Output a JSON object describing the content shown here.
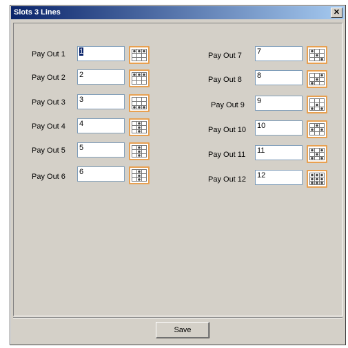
{
  "window": {
    "title": "Slots 3 Lines"
  },
  "payouts": [
    {
      "label": "Pay Out 1",
      "value": "1",
      "icon": "payline-top-row-icon"
    },
    {
      "label": "Pay Out 2",
      "value": "2",
      "icon": "payline-top-row-icon"
    },
    {
      "label": "Pay Out 3",
      "value": "3",
      "icon": "payline-bottom-row-icon"
    },
    {
      "label": "Pay Out 4",
      "value": "4",
      "icon": "payline-center-column-icon"
    },
    {
      "label": "Pay Out 5",
      "value": "5",
      "icon": "payline-center-column-icon"
    },
    {
      "label": "Pay Out 6",
      "value": "6",
      "icon": "payline-center-column-icon"
    },
    {
      "label": "Pay Out 7",
      "value": "7",
      "icon": "payline-diagonal-icon"
    },
    {
      "label": "Pay Out 8",
      "value": "8",
      "icon": "payline-diagonal-icon"
    },
    {
      "label": "Pay Out 9",
      "value": "9",
      "icon": "payline-diagonal-icon"
    },
    {
      "label": "Pay Out 10",
      "value": "10",
      "icon": "payline-v-shape-icon"
    },
    {
      "label": "Pay Out 11",
      "value": "11",
      "icon": "payline-x-shape-icon"
    },
    {
      "label": "Pay Out 12",
      "value": "12",
      "icon": "payline-all-cells-icon"
    }
  ],
  "footer": {
    "save_label": "Save"
  },
  "colors": {
    "titlebar_start": "#0a246a",
    "titlebar_end": "#a6caf0",
    "icon_border": "#e8a050",
    "dialog_bg": "#d4d0c8"
  }
}
